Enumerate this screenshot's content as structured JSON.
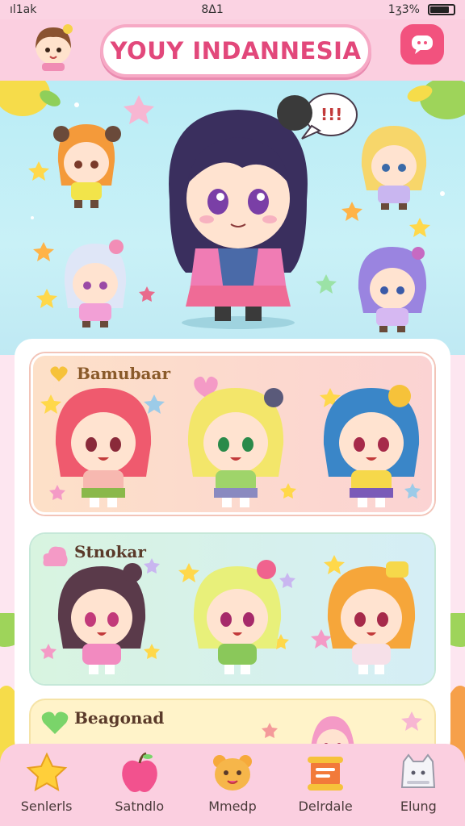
{
  "status_bar": {
    "signal": "ıl1ak",
    "time": "8Δ1",
    "battery": "1ʒ3%",
    "battery_level": 0.82
  },
  "header": {
    "title": "YOUY INDANNESIA"
  },
  "sections": [
    {
      "label": "Bamubaar"
    },
    {
      "label": "Stnokar"
    },
    {
      "label": "Beagonad"
    }
  ],
  "hero": {
    "speech": "!!!"
  },
  "bottom_nav": [
    {
      "label": "Senlerls",
      "icon": "star-icon"
    },
    {
      "label": "Satndlo",
      "icon": "apple-icon"
    },
    {
      "label": "Mmedp",
      "icon": "bear-icon"
    },
    {
      "label": "Delrdale",
      "icon": "scroll-icon"
    },
    {
      "label": "Elung",
      "icon": "cat-icon"
    }
  ],
  "colors": {
    "accent": "#e2487b",
    "header_bg": "#fbcfe0",
    "hero_bg": "#b9ecf6"
  }
}
